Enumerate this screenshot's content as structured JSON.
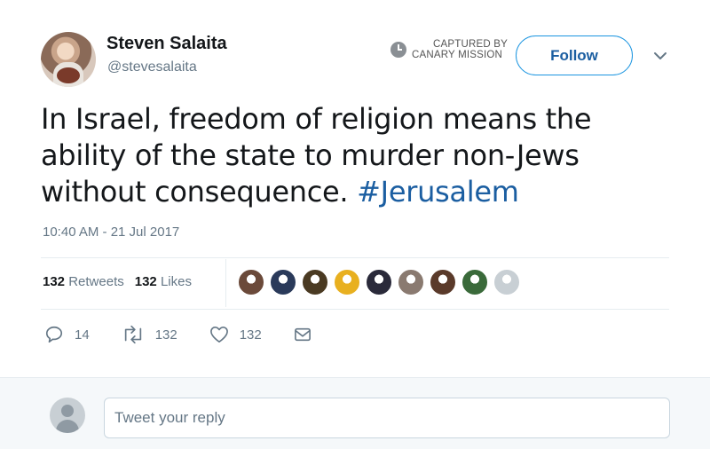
{
  "tweet": {
    "author_name": "Steven Salaita",
    "author_handle": "@stevesalaita",
    "text": "In Israel, freedom of religion means the ability of the state to murder non-Jews without consequence.  ",
    "hashtag": "#Jerusalem",
    "timestamp": "10:40 AM - 21 Jul 2017"
  },
  "watermark": {
    "line1": "CAPTURED BY",
    "line2": "CANARY MISSION"
  },
  "header": {
    "follow_label": "Follow"
  },
  "stats": {
    "retweets_count": "132",
    "retweets_label": "Retweets",
    "likes_count": "132",
    "likes_label": "Likes"
  },
  "likers": [
    {
      "color": "#6b4a3a"
    },
    {
      "color": "#2a3a5a"
    },
    {
      "color": "#4a3a22"
    },
    {
      "color": "#e8b020"
    },
    {
      "color": "#2a2a3a"
    },
    {
      "color": "#8a7a70"
    },
    {
      "color": "#5a3a2a"
    },
    {
      "color": "#3a6a3a"
    },
    {
      "color": "#c8cfd4"
    }
  ],
  "actions": {
    "reply_count": "14",
    "retweet_count": "132",
    "like_count": "132"
  },
  "reply": {
    "placeholder": "Tweet your reply"
  },
  "icons": {
    "clock": "clock-icon",
    "chevron": "chevron-down-icon",
    "reply": "reply-icon",
    "retweet": "retweet-icon",
    "like": "heart-icon",
    "dm": "envelope-icon"
  },
  "colors": {
    "link": "#1b5ea1",
    "follow_border": "#1b95e0",
    "muted": "#657786"
  }
}
